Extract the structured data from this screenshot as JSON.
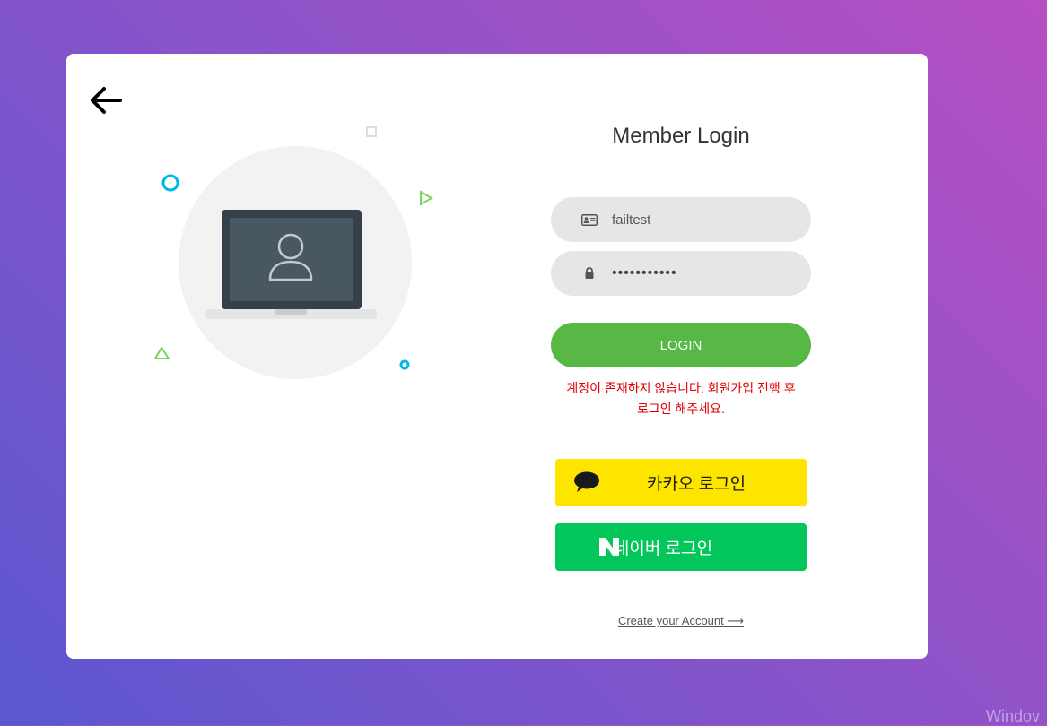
{
  "login": {
    "title": "Member Login",
    "username_value": "failtest",
    "password_value": "•••••••••••",
    "login_button": "LOGIN",
    "error_line1": "계정이 존재하지 않습니다. 회원가입 진행 후",
    "error_line2": "로그인 해주세요.",
    "kakao_button": "카카오 로그인",
    "naver_button": "네이버 로그인",
    "create_account": "Create your Account ⟶"
  },
  "colors": {
    "background_start": "#b64fc2",
    "background_end": "#5a57cf",
    "login_button": "#57b846",
    "kakao": "#fee500",
    "naver": "#03c75a",
    "error": "#e00000"
  },
  "icons": {
    "back": "arrow-left-icon",
    "username": "id-card-icon",
    "password": "lock-icon",
    "kakao": "speech-bubble-icon",
    "naver": "naver-n-icon"
  },
  "watermark": "Windov"
}
